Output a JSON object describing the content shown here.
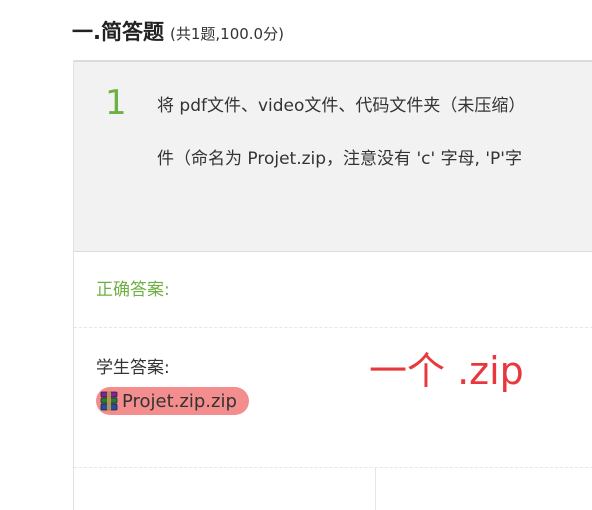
{
  "section": {
    "title": "一.简答题",
    "meta": "(共1题,100.0分)"
  },
  "question": {
    "number": "1",
    "line1": "将 pdf文件、video文件、代码文件夹（未压缩）",
    "line2": "件（命名为 Projet.zip，注意没有 'c' 字母, 'P'字"
  },
  "answers": {
    "correct_label": "正确答案:",
    "student_label": "学生答案:",
    "attachment_name": "Projet.zip.zip",
    "attachment_icon": "archive-file-icon"
  },
  "annotation": {
    "text": "一个 .zip",
    "color": "#e8383d"
  },
  "colors": {
    "accent_green": "#6fb043",
    "attachment_bg": "#f48e8e"
  }
}
